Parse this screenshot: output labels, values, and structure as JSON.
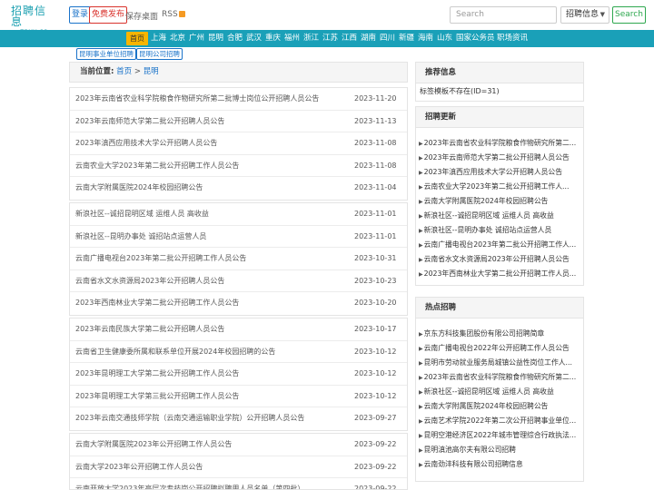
{
  "header": {
    "logo_line1": "招聘信息",
    "logo_line2": "zpxx.cc",
    "login_label": "登录",
    "post_label": "免费发布",
    "desktop_label": "保存桌面",
    "rss_label": "RSS",
    "search_placeholder": "Search",
    "search_select_value": "招聘信息",
    "search_button": "Search"
  },
  "nav": {
    "home": "首页",
    "items": [
      "上海",
      "北京",
      "广州",
      "昆明",
      "合肥",
      "武汉",
      "重庆",
      "福州",
      "浙江",
      "江苏",
      "江西",
      "湖南",
      "四川",
      "新疆",
      "海南",
      "山东",
      "国家公务员",
      "职场资讯"
    ]
  },
  "subtags": [
    "昆明事业单位招聘",
    "昆明公司招聘"
  ],
  "breadcrumb": {
    "label": "当前位置:",
    "home": "首页",
    "sep": ">",
    "current": "昆明"
  },
  "list_groups": [
    [
      {
        "title": "2023年云南省农业科学院粮食作物研究所第二批博士岗位公开招聘人员公告",
        "date": "2023-11-20"
      },
      {
        "title": "2023年云南师范大学第二批公开招聘人员公告",
        "date": "2023-11-13"
      },
      {
        "title": "2023年滇西应用技术大学公开招聘人员公告",
        "date": "2023-11-08"
      },
      {
        "title": "云南农业大学2023年第二批公开招聘工作人员公告",
        "date": "2023-11-08"
      },
      {
        "title": "云南大学附属医院2024年校园招聘公告",
        "date": "2023-11-04"
      }
    ],
    [
      {
        "title": "新浪社区--诚招昆明区域 运维人员 高收益",
        "date": "2023-11-01"
      },
      {
        "title": "新浪社区--昆明办事处 诚招站点运营人员",
        "date": "2023-11-01"
      },
      {
        "title": "云南广播电视台2023年第二批公开招聘工作人员公告",
        "date": "2023-10-31"
      },
      {
        "title": "云南省水文水资源局2023年公开招聘人员公告",
        "date": "2023-10-23"
      },
      {
        "title": "2023年西南林业大学第二批公开招聘工作人员公告",
        "date": "2023-10-20"
      }
    ],
    [
      {
        "title": "2023年云南民族大学第二批公开招聘人员公告",
        "date": "2023-10-17"
      },
      {
        "title": "云南省卫生健康委所属和联系单位开展2024年校园招聘的公告",
        "date": "2023-10-12"
      },
      {
        "title": "2023年昆明理工大学第二批公开招聘工作人员公告",
        "date": "2023-10-12"
      },
      {
        "title": "2023年昆明理工大学第三批公开招聘工作人员公告",
        "date": "2023-10-12"
      },
      {
        "title": "2023年云南交通技师学院（云南交通运输职业学院）公开招聘人员公告",
        "date": "2023-09-27"
      }
    ],
    [
      {
        "title": "云南大学附属医院2023年公开招聘工作人员公告",
        "date": "2023-09-22"
      },
      {
        "title": "云南大学2023年公开招聘工作人员公告",
        "date": "2023-09-22"
      },
      {
        "title": "云南开放大学2023年高层次专技岗公开招聘拟聘用人员名单（第四批）",
        "date": "2023-09-22"
      }
    ]
  ],
  "sidebar": {
    "recommend": {
      "title": "推荐信息",
      "text": "标签模板不存在(ID=31)"
    },
    "updates": {
      "title": "招聘更新",
      "items": [
        "2023年云南省农业科学院粮食作物研究所第二...",
        "2023年云南师范大学第二批公开招聘人员公告",
        "2023年滇西应用技术大学公开招聘人员公告",
        "云南农业大学2023年第二批公开招聘工作人...",
        "云南大学附属医院2024年校园招聘公告",
        "新浪社区--诚招昆明区域 运维人员 高收益",
        "新浪社区--昆明办事处 诚招站点运营人员",
        "云南广播电视台2023年第二批公开招聘工作人...",
        "云南省水文水资源局2023年公开招聘人员公告",
        "2023年西南林业大学第二批公开招聘工作人员..."
      ]
    },
    "hot": {
      "title": "热点招聘",
      "items": [
        "京东方科技集团股份有限公司招聘简章",
        "云南广播电视台2022年公开招聘工作人员公告",
        "昆明市劳动就业服务局城镇公益性岗位工作人...",
        "2023年云南省农业科学院粮食作物研究所第二...",
        "新浪社区--诚招昆明区域 运维人员 高收益",
        "云南大学附属医院2024年校园招聘公告",
        "云南艺术学院2022年第二次公开招聘事业单位...",
        "昆明空港经济区2022年城市管理综合行政执法...",
        "昆明滇池高尔夫有限公司招聘",
        "云南劲沣科技有限公司招聘信息"
      ]
    }
  },
  "colors": {
    "nav_bg": "#1aa0b8",
    "home_tab": "#f7b500",
    "link": "#1a73c9",
    "post_red": "#d9322c",
    "search_green": "#2ea84f"
  }
}
